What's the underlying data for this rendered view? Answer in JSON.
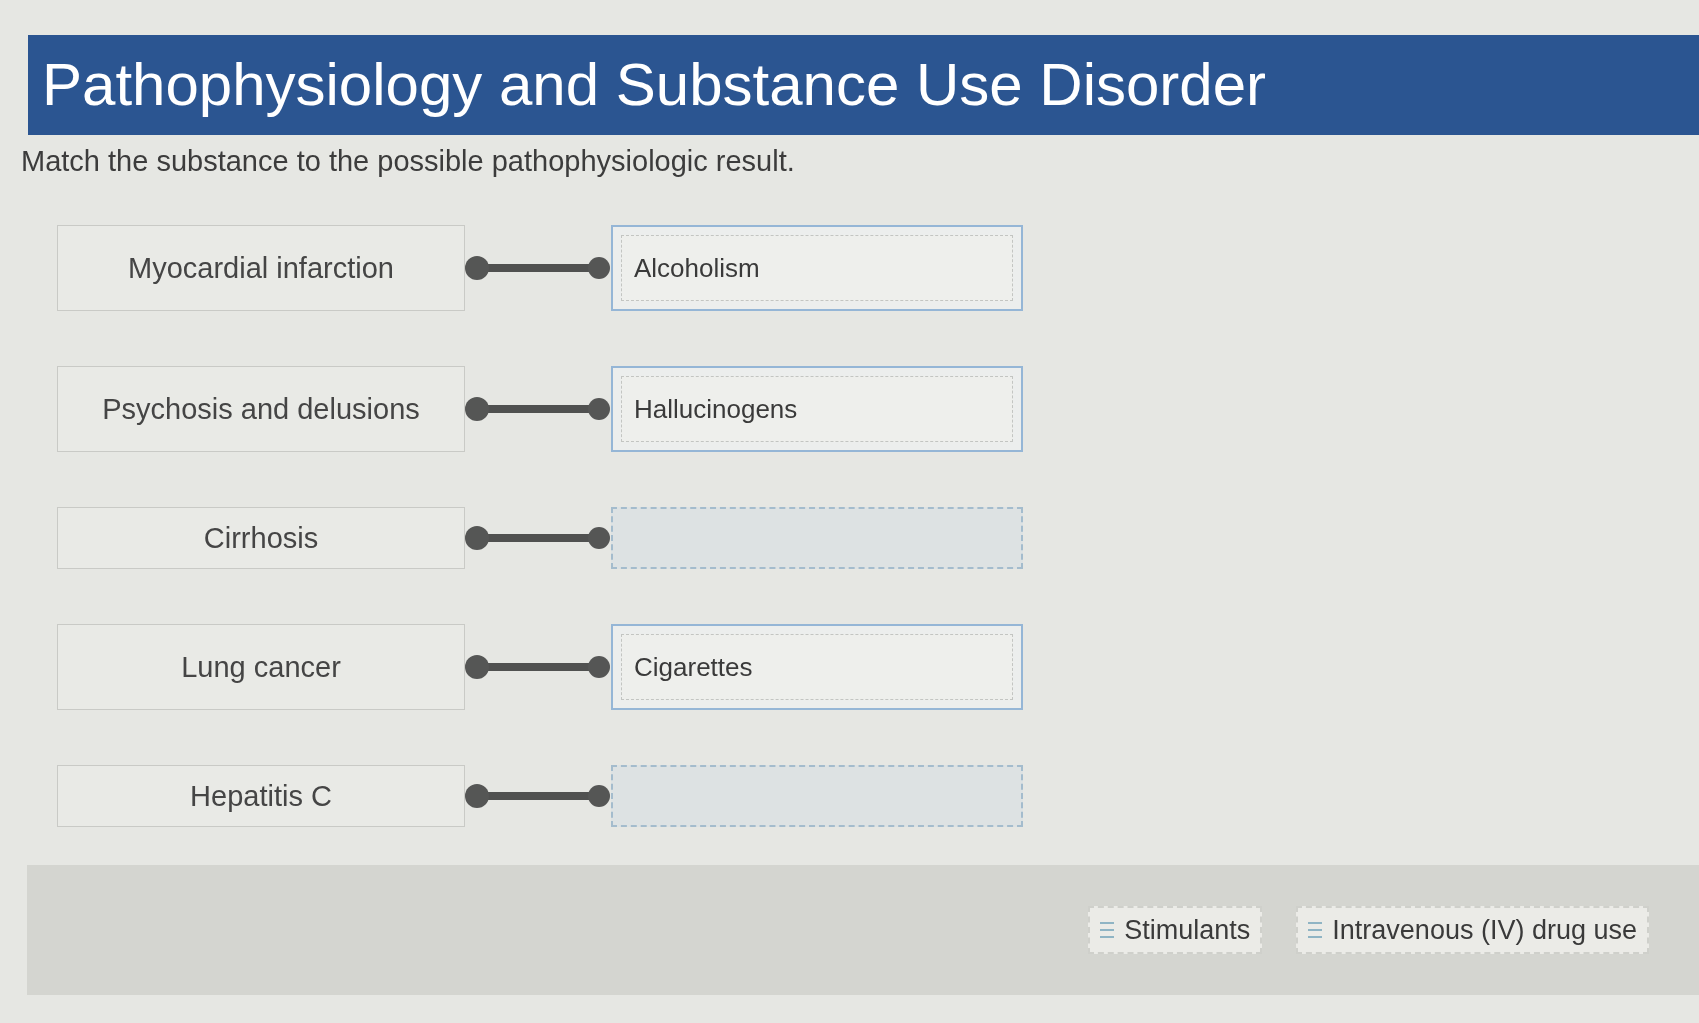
{
  "title": "Pathophysiology and Substance Use Disorder",
  "instructions": "Match the substance to the possible pathophysiologic result.",
  "matches": [
    {
      "prompt": "Myocardial infarction",
      "answer": "Alcoholism"
    },
    {
      "prompt": "Psychosis and delusions",
      "answer": "Hallucinogens"
    },
    {
      "prompt": "Cirrhosis"
    },
    {
      "prompt": "Lung cancer",
      "answer": "Cigarettes"
    },
    {
      "prompt": "Hepatitis C"
    }
  ],
  "answer_bank": [
    {
      "label": "Stimulants"
    },
    {
      "label": "Intravenous (IV) drug use"
    }
  ]
}
